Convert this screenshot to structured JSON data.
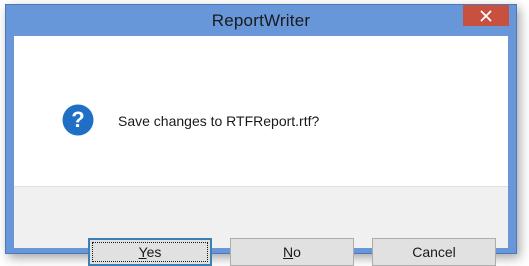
{
  "window": {
    "title": "ReportWriter",
    "close_glyph": "✕"
  },
  "dialog": {
    "icon": "question-icon",
    "icon_glyph": "?",
    "message": "Save changes to RTFReport.rtf?"
  },
  "buttons": {
    "yes": {
      "mnemonic": "Y",
      "rest": "es"
    },
    "no": {
      "mnemonic": "N",
      "rest": "o"
    },
    "cancel": {
      "label": "Cancel"
    }
  },
  "colors": {
    "titlebar": "#6797d8",
    "close": "#c7503f",
    "icon": "#1f6fc5"
  }
}
